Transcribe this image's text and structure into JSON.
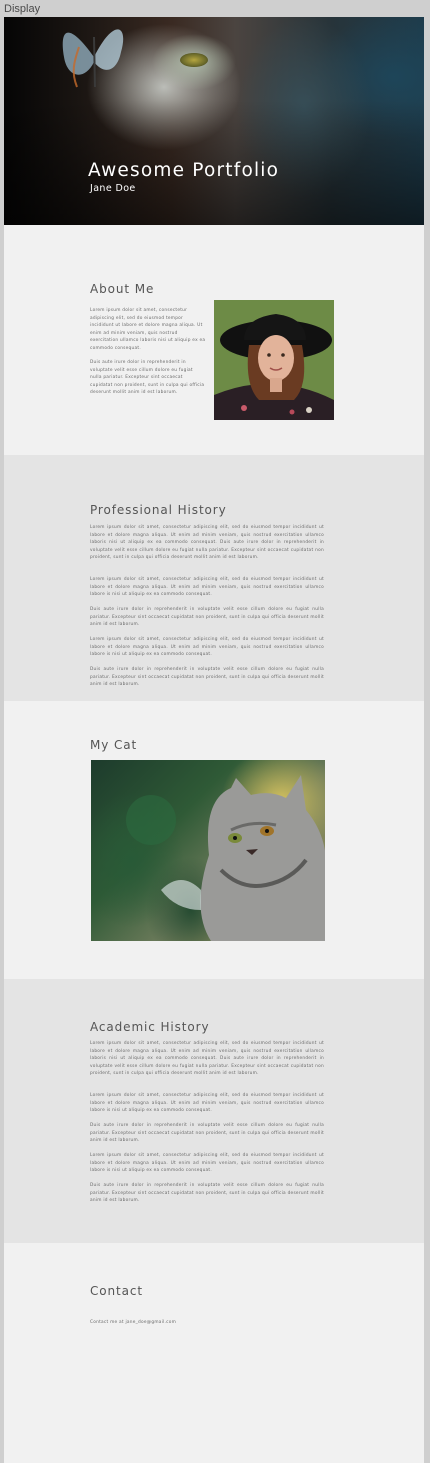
{
  "canvas": {
    "label": "Display"
  },
  "hero": {
    "title": "Awesome Portfolio",
    "subtitle": "Jane Doe"
  },
  "about": {
    "title": "About Me",
    "paragraphs": [
      "Lorem ipsum dolor sit amet, consectetur adipiscing elit, sed do eiusmod tempor incididunt ut labore et dolore magna aliqua. Ut enim ad minim veniam, quis nostrud exercitation ullamco laboris nisi ut aliquip ex ea commodo consequat.",
      "Duis aute irure dolor in reprehenderit in voluptate velit esse cillum dolore eu fugiat nulla pariatur. Excepteur sint occaecat cupidatat non proident, sunt in culpa qui officia deserunt mollit anim id est laborum."
    ]
  },
  "professional": {
    "title": "Professional History",
    "paragraphs": [
      "Lorem ipsum dolor sit amet, consectetur adipiscing elit, sed do eiusmod tempor incididunt ut labore et dolore magna aliqua. Ut enim ad minim veniam, quis nostrud exercitation ullamco laboris nisi ut aliquip ex ea commodo consequat. Duis aute irure dolor in reprehenderit in voluptate velit esse cillum dolore eu fugiat nulla pariatur. Excepteur sint occaecat cupidatat non proident, sunt in culpa qui officia deserunt mollit anim id est laborum.",
      "Lorem ipsum dolor sit amet, consectetur adipiscing elit, sed do eiusmod tempor incididunt ut labore et dolore magna aliqua. Ut enim ad minim veniam, quis nostrud exercitation ullamco labore is nisi ut aliquip ex ea commodo consequat.",
      "Duis aute irure dolor in reprehenderit in voluptate velit esse cillum dolore eu fugiat nulla pariatur. Excepteur sint occaecat cupidatat non proident, sunt in culpa qui officia deserunt mollit anim id est laborum.",
      "Lorem ipsum dolor sit amet, consectetur adipiscing elit, sed do eiusmod tempor incididunt ut labore et dolore magna aliqua. Ut enim ad minim veniam, quis nostrud exercitation ullamco labore is nisi ut aliquip ex ea commodo consequat.",
      "Duis aute irure dolor in reprehenderit in voluptate velit esse cillum dolore eu fugiat nulla pariatur. Excepteur sint occaecat cupidatat non proident, sunt in culpa qui officia deserunt mollit anim id est laborum."
    ]
  },
  "cat": {
    "title": "My Cat"
  },
  "academic": {
    "title": "Academic History",
    "paragraphs": [
      "Lorem ipsum dolor sit amet, consectetur adipiscing elit, sed do eiusmod tempor incididunt ut labore et dolore magna aliqua. Ut enim ad minim veniam, quis nostrud exercitation ullamco laboris nisi ut aliquip ex ea commodo consequat. Duis aute irure dolor in reprehenderit in voluptate velit esse cillum dolore eu fugiat nulla pariatur. Excepteur sint occaecat cupidatat non proident, sunt in culpa qui officia deserunt mollit anim id est laborum.",
      "Lorem ipsum dolor sit amet, consectetur adipiscing elit, sed do eiusmod tempor incididunt ut labore et dolore magna aliqua. Ut enim ad minim veniam, quis nostrud exercitation ullamco labore is nisi ut aliquip ex ea commodo consequat.",
      "Duis aute irure dolor in reprehenderit in voluptate velit esse cillum dolore eu fugiat nulla pariatur. Excepteur sint occaecat cupidatat non proident, sunt in culpa qui officia deserunt mollit anim id est laborum.",
      "Lorem ipsum dolor sit amet, consectetur adipiscing elit, sed do eiusmod tempor incididunt ut labore et dolore magna aliqua. Ut enim ad minim veniam, quis nostrud exercitation ullamco labore is nisi ut aliquip ex ea commodo consequat.",
      "Duis aute irure dolor in reprehenderit in voluptate velit esse cillum dolore eu fugiat nulla pariatur. Excepteur sint occaecat cupidatat non proident, sunt in culpa qui officia deserunt mollit anim id est laborum."
    ]
  },
  "contact": {
    "title": "Contact",
    "line": "Contact me at jane_doe@gmail.com"
  }
}
